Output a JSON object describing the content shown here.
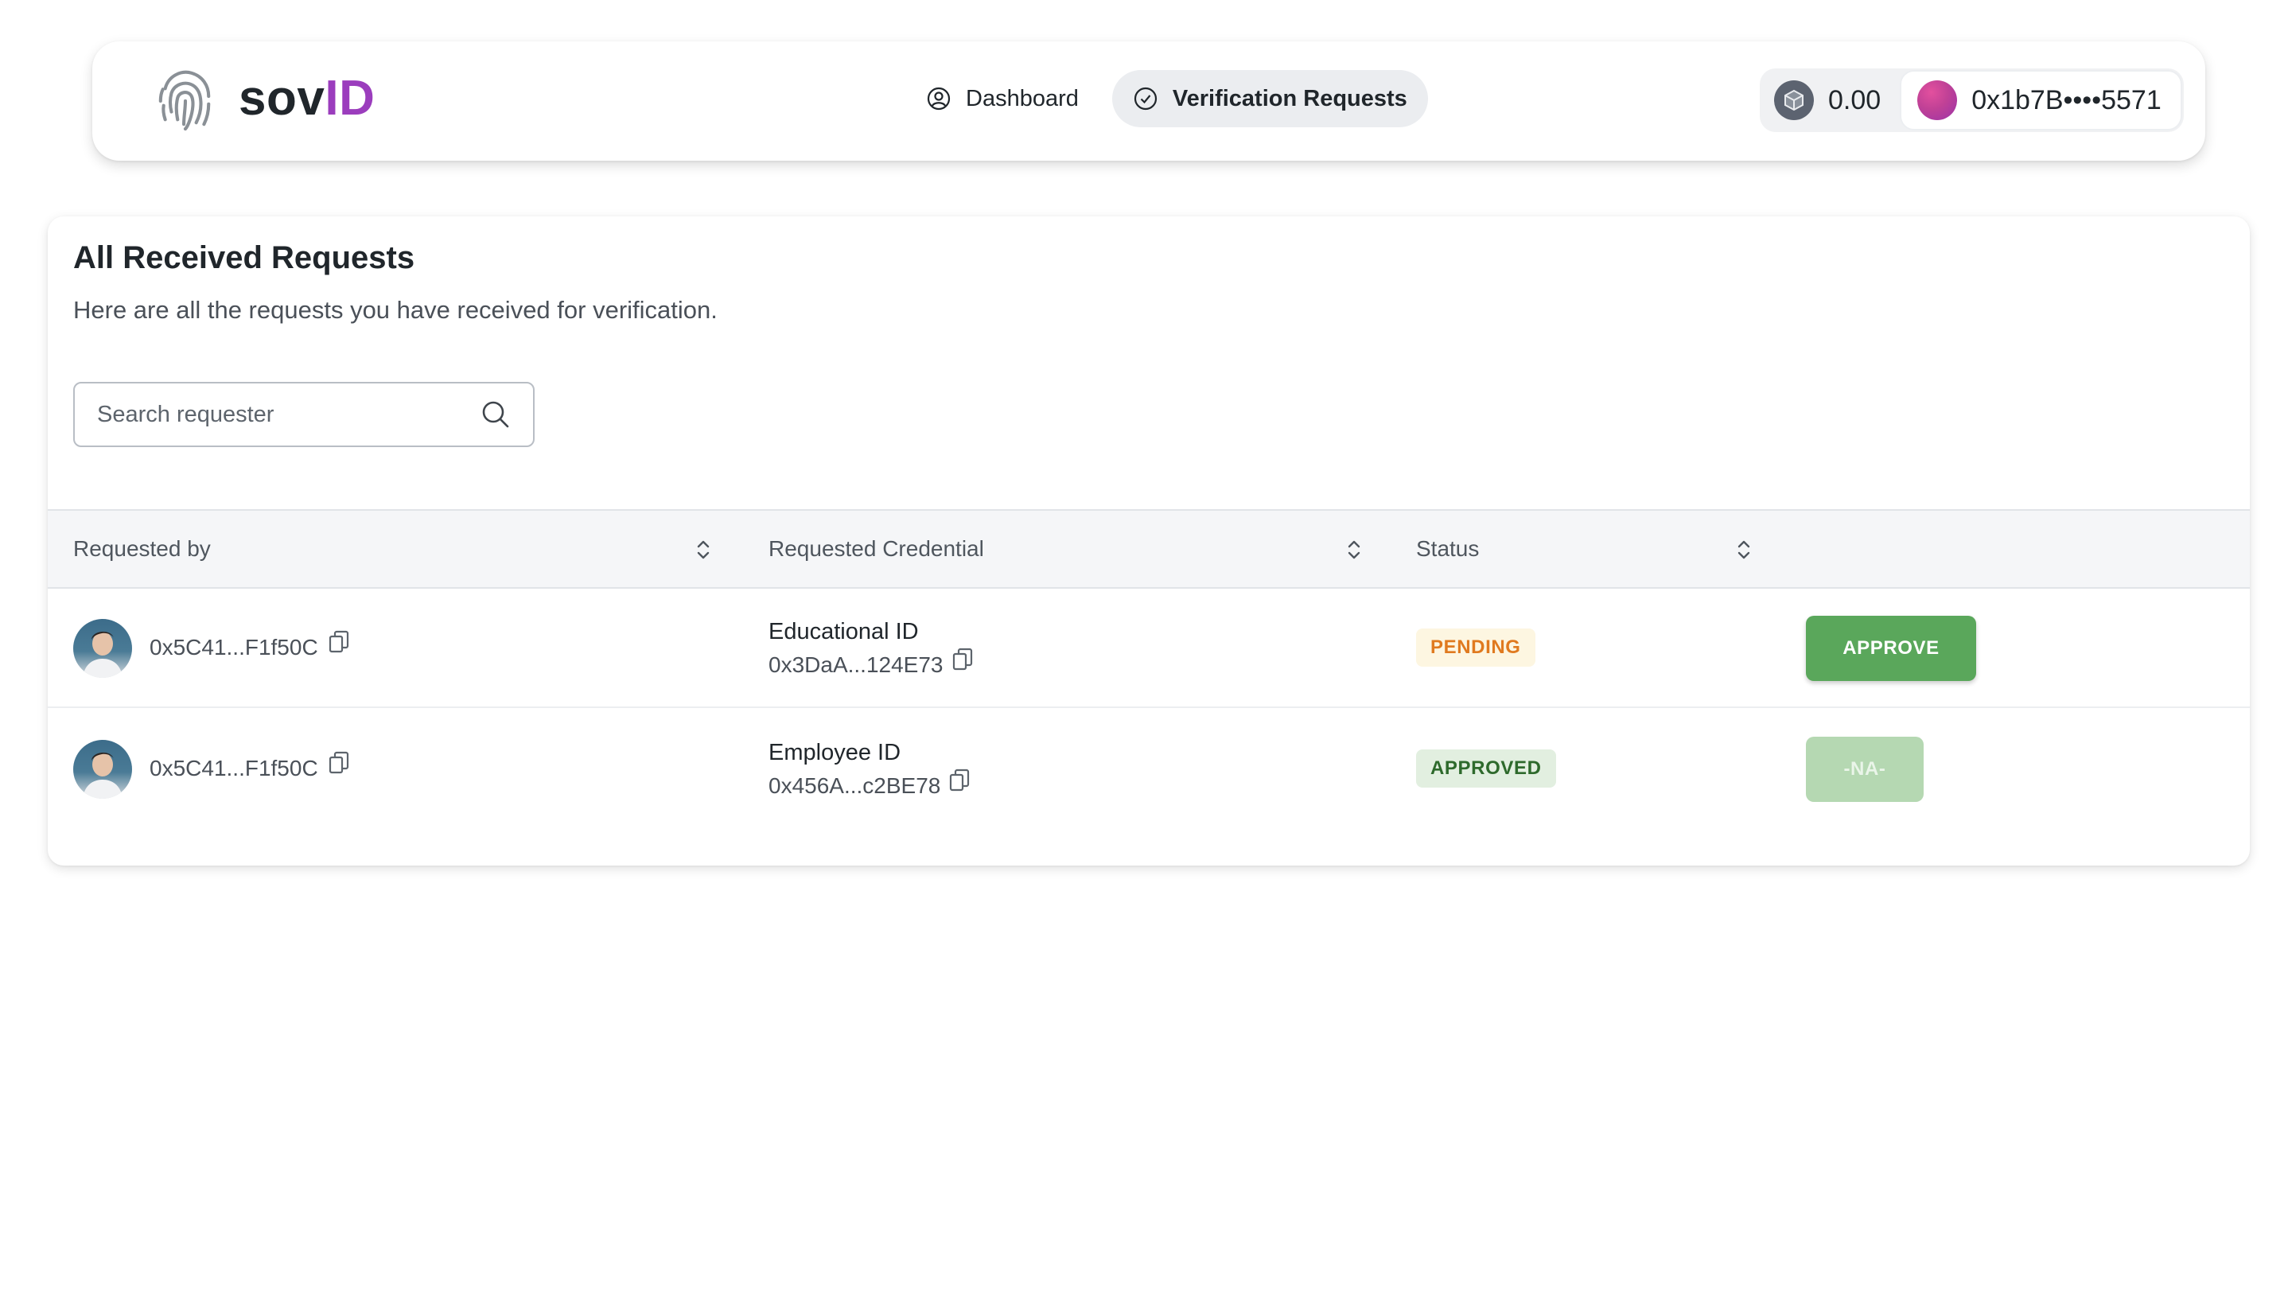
{
  "brand": {
    "prefix": "sov",
    "accent": "ID",
    "accent_color": "#9b3dbd",
    "logo_icon": "fingerprint-icon"
  },
  "nav": {
    "items": [
      {
        "label": "Dashboard",
        "icon": "user-circle-icon",
        "active": false
      },
      {
        "label": "Verification Requests",
        "icon": "check-circle-icon",
        "active": true
      }
    ]
  },
  "wallet": {
    "balance": "0.00",
    "balance_icon": "cube-icon",
    "account_address": "0x1b7B••••5571"
  },
  "page": {
    "title": "All Received Requests",
    "subtitle": "Here are all the requests you have received for verification."
  },
  "search": {
    "placeholder": "Search requester",
    "value": ""
  },
  "table": {
    "columns": [
      "Requested by",
      "Requested Credential",
      "Status",
      ""
    ],
    "rows": [
      {
        "requester": "0x5C41...F1f50C",
        "credential_name": "Educational ID",
        "credential_address": "0x3DaA...124E73",
        "status": "PENDING",
        "action": "APPROVE"
      },
      {
        "requester": "0x5C41...F1f50C",
        "credential_name": "Employee ID",
        "credential_address": "0x456A...c2BE78",
        "status": "APPROVED",
        "action": "-NA-"
      }
    ]
  },
  "colors": {
    "approve_button": "#5aa75b",
    "disabled_button": "#b5d8b2",
    "pending_text": "#e07a1f",
    "approved_text": "#2e6a2c"
  }
}
